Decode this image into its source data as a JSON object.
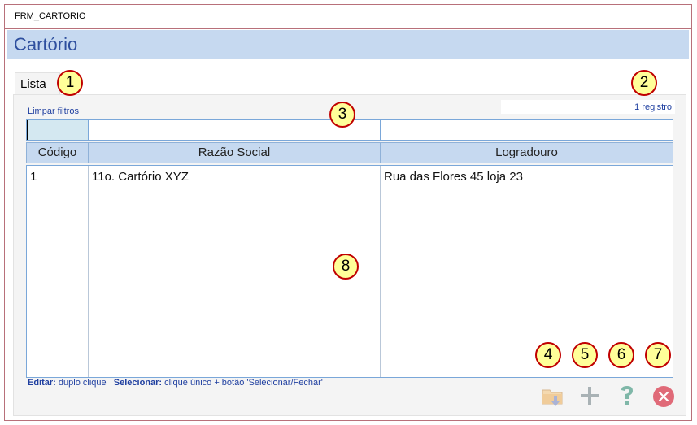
{
  "window": {
    "title": "FRM_CARTORIO"
  },
  "header": {
    "title": "Cartório"
  },
  "tab": {
    "label": "Lista"
  },
  "toolbar": {
    "clear_filters": "Limpar filtros",
    "record_count": "1 registro"
  },
  "table": {
    "columns": [
      "Código",
      "Razão Social",
      "Logradouro"
    ],
    "rows": [
      {
        "codigo": "1",
        "razao_social": "11o. Cartório XYZ",
        "logradouro": "Rua das Flores 45 loja 23"
      }
    ]
  },
  "hint": {
    "edit_label": "Editar:",
    "edit_text": "duplo clique",
    "select_label": "Selecionar:",
    "select_text": "clique único + botão 'Selecionar/Fechar'"
  },
  "buttons": [
    {
      "name": "folder-down-button",
      "icon": "folder-down-icon"
    },
    {
      "name": "add-button",
      "icon": "plus-icon"
    },
    {
      "name": "help-button",
      "icon": "question-icon"
    },
    {
      "name": "close-button",
      "icon": "close-circle-icon"
    }
  ],
  "callouts": [
    "1",
    "2",
    "3",
    "4",
    "5",
    "6",
    "7",
    "8"
  ],
  "colors": {
    "header_bg": "#c6d9f0",
    "title_blue": "#2e4f9e",
    "callout_fill": "#ffff99",
    "callout_border": "#c00000",
    "close_red": "#e06a78"
  }
}
